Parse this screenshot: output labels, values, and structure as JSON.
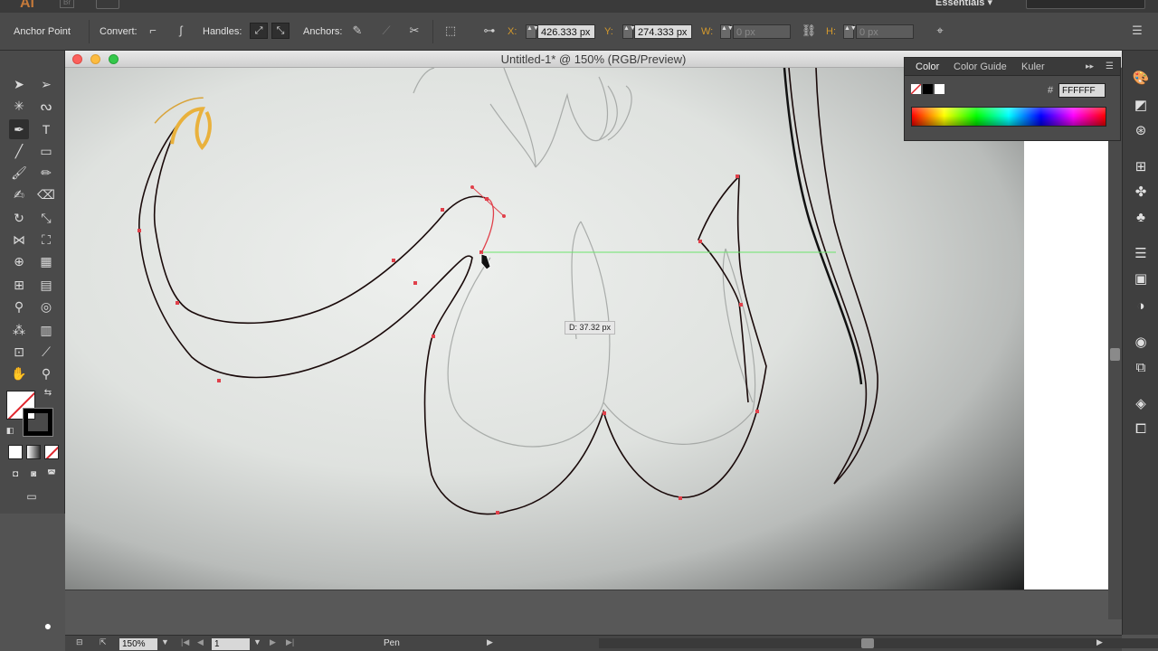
{
  "appbar": {
    "app_logo": "Ai",
    "bridge_label": "Br",
    "workspace": "Essentials ▾"
  },
  "controlbar": {
    "tool_name": "Anchor Point",
    "convert_label": "Convert:",
    "handles_label": "Handles:",
    "anchors_label": "Anchors:",
    "x_label": "X:",
    "x_value": "426.333 px",
    "y_label": "Y:",
    "y_value": "274.333 px",
    "w_label": "W:",
    "w_value": "0 px",
    "h_label": "H:",
    "h_value": "0 px"
  },
  "document": {
    "title": "Untitled-1* @ 150% (RGB/Preview)",
    "distance_tooltip": "D: 37.32 px"
  },
  "color_panel": {
    "tabs": [
      "Color",
      "Color Guide",
      "Kuler"
    ],
    "active_tab": "Color",
    "hex_label": "#",
    "hex_value": "FFFFFF",
    "colors": {
      "fill": "#FFFFFF",
      "stroke": "#000000",
      "none_indicator": "#E0252C"
    }
  },
  "statusbar": {
    "zoom": "150%",
    "artboard_number": "1",
    "current_tool": "Pen"
  },
  "colors": {
    "path_stroke": "#1a0a0a",
    "anchor_highlight": "#e0404a",
    "smart_guide": "#6be46b",
    "accent_orange": "#d59a2c"
  }
}
